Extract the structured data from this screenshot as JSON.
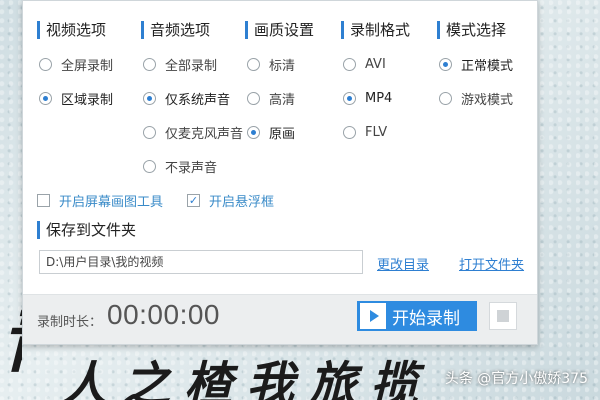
{
  "columns": [
    {
      "title": "视频选项",
      "options": [
        {
          "label": "全屏录制",
          "checked": false
        },
        {
          "label": "区域录制",
          "checked": true
        }
      ]
    },
    {
      "title": "音频选项",
      "options": [
        {
          "label": "全部录制",
          "checked": false
        },
        {
          "label": "仅系统声音",
          "checked": true
        },
        {
          "label": "仅麦克风声音",
          "checked": false
        },
        {
          "label": "不录声音",
          "checked": false
        }
      ]
    },
    {
      "title": "画质设置",
      "options": [
        {
          "label": "标清",
          "checked": false
        },
        {
          "label": "高清",
          "checked": false
        },
        {
          "label": "原画",
          "checked": true
        }
      ]
    },
    {
      "title": "录制格式",
      "options": [
        {
          "label": "AVI",
          "checked": false
        },
        {
          "label": "MP4",
          "checked": true
        },
        {
          "label": "FLV",
          "checked": false
        }
      ]
    },
    {
      "title": "模式选择",
      "options": [
        {
          "label": "正常模式",
          "checked": true
        },
        {
          "label": "游戏模式",
          "checked": false
        }
      ]
    }
  ],
  "tools": {
    "screen_draw_label": "开启屏幕画图工具",
    "screen_draw_checked": false,
    "float_box_label": "开启悬浮框",
    "float_box_checked": true
  },
  "save": {
    "title": "保存到文件夹",
    "path": "D:\\用户目录\\我的视频",
    "change_link": "更改目录",
    "open_link": "打开文件夹"
  },
  "footer": {
    "duration_label": "录制时长：",
    "duration_value": "00:00:00",
    "record_button": "开始录制"
  },
  "watermark": "头条 @官方小傲娇375",
  "colors": {
    "accent": "#2e7fd1",
    "button": "#2e8be0"
  }
}
